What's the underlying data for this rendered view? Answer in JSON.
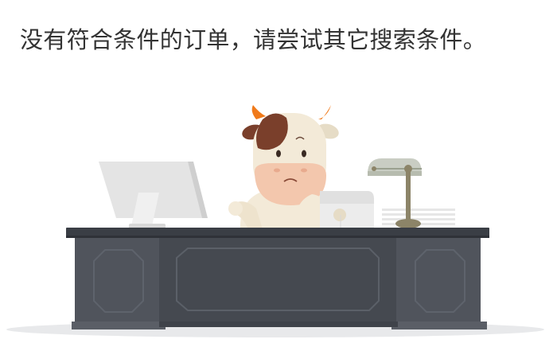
{
  "empty_state": {
    "message": "没有符合条件的订单，请尝试其它搜索条件。",
    "illustration": "cow-sitting-at-office-desk",
    "colors": {
      "desk": "#4b4f57",
      "desk_top": "#3a3e45",
      "cow_face": "#f3ead8",
      "cow_spot": "#7a3f2b",
      "cow_horn": "#f07a1a",
      "cow_muzzle": "#f3c7ad",
      "monitor": "#e6e6e6",
      "lamp_shade": "#c9cdc3",
      "lamp_pole": "#8c8468"
    }
  }
}
